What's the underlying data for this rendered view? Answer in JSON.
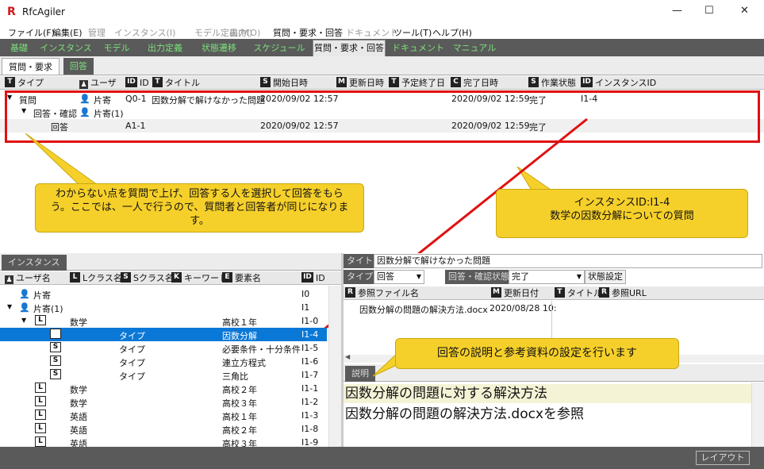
{
  "app": {
    "title": "RfcAgiler",
    "logo": "R"
  },
  "window": {
    "minimize": "—",
    "maximize": "☐",
    "close": "✕"
  },
  "menu": [
    {
      "label": "ファイル(F)",
      "enabled": true
    },
    {
      "label": "編集(E)",
      "enabled": true
    },
    {
      "label": "管理",
      "enabled": false
    },
    {
      "label": "インスタンス(I)",
      "enabled": false
    },
    {
      "label": "モデル定義(M)",
      "enabled": false
    },
    {
      "label": "出力(O)",
      "enabled": false
    },
    {
      "label": "質問・要求・回答",
      "enabled": true
    },
    {
      "label": "ドキュメント",
      "enabled": false
    },
    {
      "label": "ツール(T)",
      "enabled": true
    },
    {
      "label": "ヘルプ(H)",
      "enabled": true
    }
  ],
  "tabs": [
    "基礎",
    "インスタンス",
    "モデル",
    "出力定義",
    "状態遷移",
    "スケジュール",
    "質問・要求・回答",
    "ドキュメント",
    "マニュアル"
  ],
  "subtabs": [
    "質問・要求",
    "回答"
  ],
  "top_table": {
    "headers": [
      {
        "badge": "T",
        "label": "タイプ"
      },
      {
        "badge": "person",
        "label": "ユーザ"
      },
      {
        "badge": "ID",
        "label": "ID"
      },
      {
        "badge": "T",
        "label": "タイトル"
      },
      {
        "badge": "S",
        "label": "開始日時"
      },
      {
        "badge": "M",
        "label": "更新日時"
      },
      {
        "badge": "T",
        "label": "予定終了日"
      },
      {
        "badge": "C",
        "label": "完了日時"
      },
      {
        "badge": "S",
        "label": "作業状態"
      },
      {
        "badge": "ID",
        "label": "インスタンスID"
      }
    ],
    "rows": [
      {
        "type": "質問",
        "user": "片寄",
        "id": "Q0-1",
        "title": "因数分解で解けなかった問題",
        "start": "2020/09/02 12:57",
        "done": "2020/09/02 12:59",
        "state": "完了",
        "instance": "I1-4"
      },
      {
        "type": "回答・確認",
        "user": "片寄(1)"
      },
      {
        "type": "回答",
        "id": "A1-1",
        "start": "2020/09/02 12:57",
        "done": "2020/09/02 12:59",
        "state": "完了"
      }
    ]
  },
  "callouts": {
    "left": "わからない点を質問で上げ、回答する人を選択して回答をもらう。ここでは、一人で行うので、質問者と回答者が同じになります。",
    "right_l1": "インスタンスID:I1-4",
    "right_l2": "数学の因数分解についての質問",
    "bottom": "回答の説明と参考資料の設定を行います"
  },
  "instance_panel": {
    "tab": "インスタンス",
    "headers": [
      {
        "badge": "person",
        "label": "ユーザ名"
      },
      {
        "badge": "L",
        "label": "Lクラス名"
      },
      {
        "badge": "S",
        "label": "Sクラス名"
      },
      {
        "badge": "K",
        "label": "キーワード"
      },
      {
        "badge": "E",
        "label": "要素名"
      },
      {
        "badge": "ID",
        "label": "ID"
      }
    ],
    "rows": [
      {
        "kind": "user",
        "user": "片寄",
        "id": "I0"
      },
      {
        "kind": "user",
        "user": "片寄(1)",
        "id": "I1"
      },
      {
        "kind": "L",
        "lclass": "数学",
        "element": "高校１年",
        "id": "I1-0"
      },
      {
        "kind": "S",
        "sclass": "タイプ",
        "element": "因数分解",
        "id": "I1-4",
        "selected": true
      },
      {
        "kind": "S",
        "sclass": "タイプ",
        "element": "必要条件・十分条件",
        "id": "I1-5"
      },
      {
        "kind": "S",
        "sclass": "タイプ",
        "element": "連立方程式",
        "id": "I1-6"
      },
      {
        "kind": "S",
        "sclass": "タイプ",
        "element": "三角比",
        "id": "I1-7"
      },
      {
        "kind": "L",
        "lclass": "数学",
        "element": "高校２年",
        "id": "I1-1"
      },
      {
        "kind": "L",
        "lclass": "数学",
        "element": "高校３年",
        "id": "I1-2"
      },
      {
        "kind": "L",
        "lclass": "英語",
        "element": "高校１年",
        "id": "I1-3"
      },
      {
        "kind": "L",
        "lclass": "英語",
        "element": "高校２年",
        "id": "I1-8"
      },
      {
        "kind": "L",
        "lclass": "英語",
        "element": "高校３年",
        "id": "I1-9"
      }
    ]
  },
  "detail": {
    "title_label": "タイトル",
    "title_value": "因数分解で解けなかった問題",
    "type_label": "タイプ",
    "type_value": "回答",
    "state_label": "回答・確認状態",
    "state_value": "完了",
    "state_button": "状態設定",
    "ref_headers": [
      {
        "badge": "R",
        "label": "参照ファイル名"
      },
      {
        "badge": "M",
        "label": "更新日付"
      },
      {
        "badge": "T",
        "label": "タイトル"
      },
      {
        "badge": "R",
        "label": "参照URL"
      }
    ],
    "ref_row": {
      "file": "因数分解の問題の解決方法.docx",
      "date": "2020/08/28 10:"
    },
    "desc_tab": "説明",
    "desc_line1": "因数分解の問題に対する解決方法",
    "desc_line2": "因数分解の問題の解決方法.docxを参照"
  },
  "bottom": {
    "layout_button": "レイアウト"
  }
}
